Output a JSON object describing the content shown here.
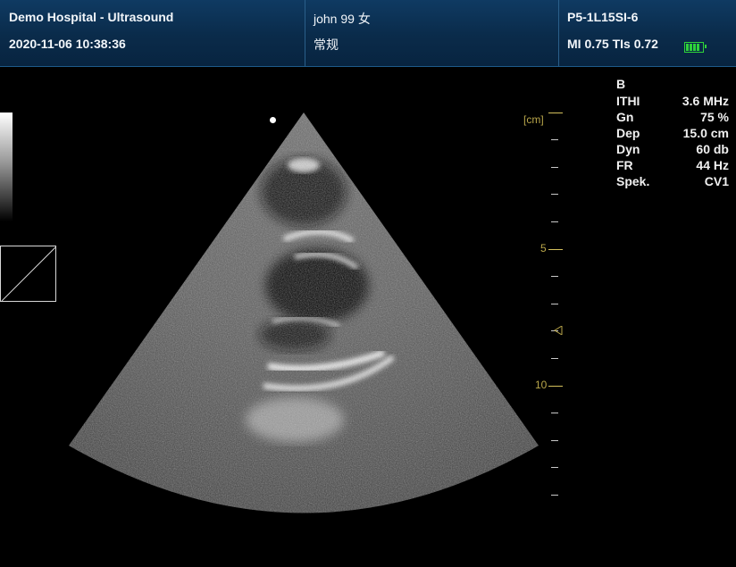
{
  "header": {
    "hospital": "Demo Hospital - Ultrasound",
    "datetime": "2020-11-06 10:38:36",
    "patient": "john 99 女",
    "exam": "常规",
    "probe": "P5-1L15SI-6",
    "indices": "MI 0.75 TIs 0.72",
    "battery_color": "#2fd23a"
  },
  "scale": {
    "unit": "[cm]",
    "labels": [
      "5",
      "10"
    ],
    "accent_color": "#b9a64a"
  },
  "params": {
    "mode": "B",
    "rows": [
      {
        "label": "ITHI",
        "value": "3.6 MHz"
      },
      {
        "label": "Gn",
        "value": "75 %"
      },
      {
        "label": "Dep",
        "value": "15.0 cm"
      },
      {
        "label": "Dyn",
        "value": "60 db"
      },
      {
        "label": "FR",
        "value": "44 Hz"
      },
      {
        "label": "Spek.",
        "value": "CV1"
      }
    ]
  },
  "icons": {
    "battery": "battery-icon",
    "focus_marker": "focus-marker-icon",
    "focus_dot": "focus-dot-icon",
    "grayscale_map": "grayscale-map-icon"
  }
}
